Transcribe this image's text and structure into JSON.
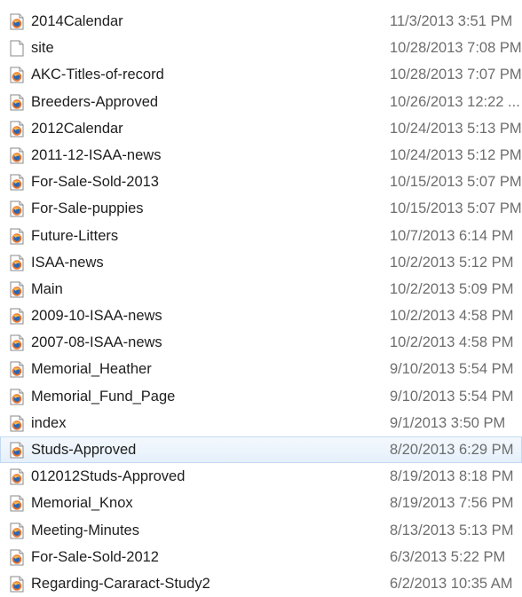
{
  "files": [
    {
      "name": "2014Calendar",
      "date": "11/3/2013 3:51 PM",
      "icon": "html-document-icon"
    },
    {
      "name": "site",
      "date": "10/28/2013 7:08 PM",
      "icon": "blank-document-icon"
    },
    {
      "name": "AKC-Titles-of-record",
      "date": "10/28/2013 7:07 PM",
      "icon": "html-document-icon"
    },
    {
      "name": "Breeders-Approved",
      "date": "10/26/2013 12:22 ...",
      "icon": "html-document-icon"
    },
    {
      "name": "2012Calendar",
      "date": "10/24/2013 5:13 PM",
      "icon": "html-document-icon"
    },
    {
      "name": "2011-12-ISAA-news",
      "date": "10/24/2013 5:12 PM",
      "icon": "html-document-icon"
    },
    {
      "name": "For-Sale-Sold-2013",
      "date": "10/15/2013 5:07 PM",
      "icon": "html-document-icon"
    },
    {
      "name": "For-Sale-puppies",
      "date": "10/15/2013 5:07 PM",
      "icon": "html-document-icon"
    },
    {
      "name": "Future-Litters",
      "date": "10/7/2013 6:14 PM",
      "icon": "html-document-icon"
    },
    {
      "name": "ISAA-news",
      "date": "10/2/2013 5:12 PM",
      "icon": "html-document-icon"
    },
    {
      "name": "Main",
      "date": "10/2/2013 5:09 PM",
      "icon": "html-document-icon"
    },
    {
      "name": "2009-10-ISAA-news",
      "date": "10/2/2013 4:58 PM",
      "icon": "html-document-icon"
    },
    {
      "name": "2007-08-ISAA-news",
      "date": "10/2/2013 4:58 PM",
      "icon": "html-document-icon"
    },
    {
      "name": "Memorial_Heather",
      "date": "9/10/2013 5:54 PM",
      "icon": "html-document-icon"
    },
    {
      "name": "Memorial_Fund_Page",
      "date": "9/10/2013 5:54 PM",
      "icon": "html-document-icon"
    },
    {
      "name": "index",
      "date": "9/1/2013 3:50 PM",
      "icon": "html-document-icon"
    },
    {
      "name": "Studs-Approved",
      "date": "8/20/2013 6:29 PM",
      "icon": "html-document-icon",
      "selected": true
    },
    {
      "name": "012012Studs-Approved",
      "date": "8/19/2013 8:18 PM",
      "icon": "html-document-icon"
    },
    {
      "name": "Memorial_Knox",
      "date": "8/19/2013 7:56 PM",
      "icon": "html-document-icon"
    },
    {
      "name": "Meeting-Minutes",
      "date": "8/13/2013 5:13 PM",
      "icon": "html-document-icon"
    },
    {
      "name": "For-Sale-Sold-2012",
      "date": "6/3/2013 5:22 PM",
      "icon": "html-document-icon"
    },
    {
      "name": "Regarding-Cararact-Study2",
      "date": "6/2/2013 10:35 AM",
      "icon": "html-document-icon"
    }
  ],
  "colors": {
    "selection_background": "#e6f0fb",
    "selection_border": "#c3d9f2",
    "name_text": "#1e1e1e",
    "date_text": "#6d6d6d"
  }
}
